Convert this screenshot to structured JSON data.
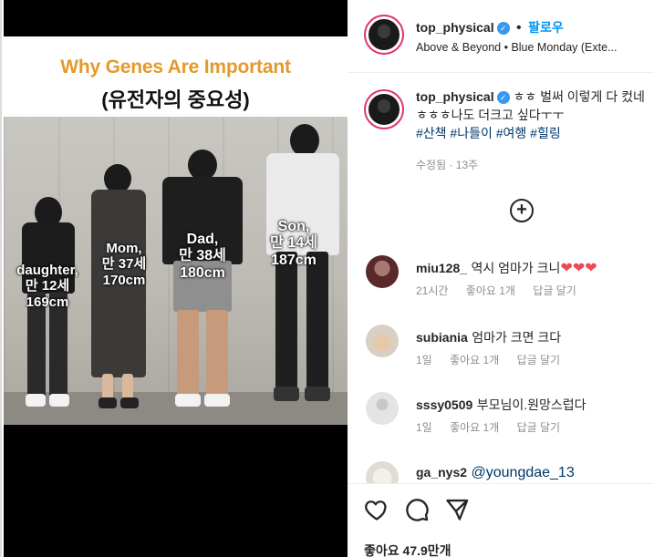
{
  "media": {
    "title_en": "Why Genes Are Important",
    "title_ko": "(유전자의 중요성)",
    "people": [
      {
        "line1": "daughter,",
        "line2": "만 12세",
        "line3": "169cm"
      },
      {
        "line1": "Mom,",
        "line2": "만 37세",
        "line3": "170cm"
      },
      {
        "line1": "Dad,",
        "line2": "만 38세",
        "line3": "180cm"
      },
      {
        "line1": "Son,",
        "line2": "만 14세",
        "line3": "187cm"
      }
    ]
  },
  "header": {
    "username": "top_physical",
    "follow_label": "팔로우",
    "song": "Above & Beyond • Blue Monday (Exte..."
  },
  "caption": {
    "username": "top_physical",
    "text": "ㅎㅎ 벌써 이렇게 다 컸네ㅎㅎㅎ나도 더크고 싶다ㅜㅜ",
    "hashtags": "#산책 #나들이 #여행 #힐링",
    "edited": "수정됨",
    "time": "13주"
  },
  "comments": [
    {
      "username": "miu128_",
      "text": "역시 엄마가 크니",
      "hearts": "❤❤❤",
      "time": "21시간",
      "likes": "좋아요 1개",
      "reply": "답글 달기"
    },
    {
      "username": "subiania",
      "text": "엄마가 크면 크다",
      "time": "1일",
      "likes": "좋아요 1개",
      "reply": "답글 달기"
    },
    {
      "username": "sssy0509",
      "text": "부모님이.원망스럽다",
      "time": "1일",
      "likes": "좋아요 1개",
      "reply": "답글 달기"
    },
    {
      "username": "ga_nys2",
      "mention": "@youngdae_13"
    }
  ],
  "actions": {
    "likes_text": "좋아요 47.9만개"
  },
  "icons": {
    "verified": "verified-badge-icon",
    "add_comments": "plus-circle-icon",
    "like": "heart-icon",
    "comment": "comment-bubble-icon",
    "share": "paper-plane-icon"
  },
  "colors": {
    "title_accent": "#e39a2d",
    "link_blue": "#0095f6",
    "hashtag": "#00376b",
    "heart": "#ed4956",
    "muted": "#8e8e8e"
  }
}
